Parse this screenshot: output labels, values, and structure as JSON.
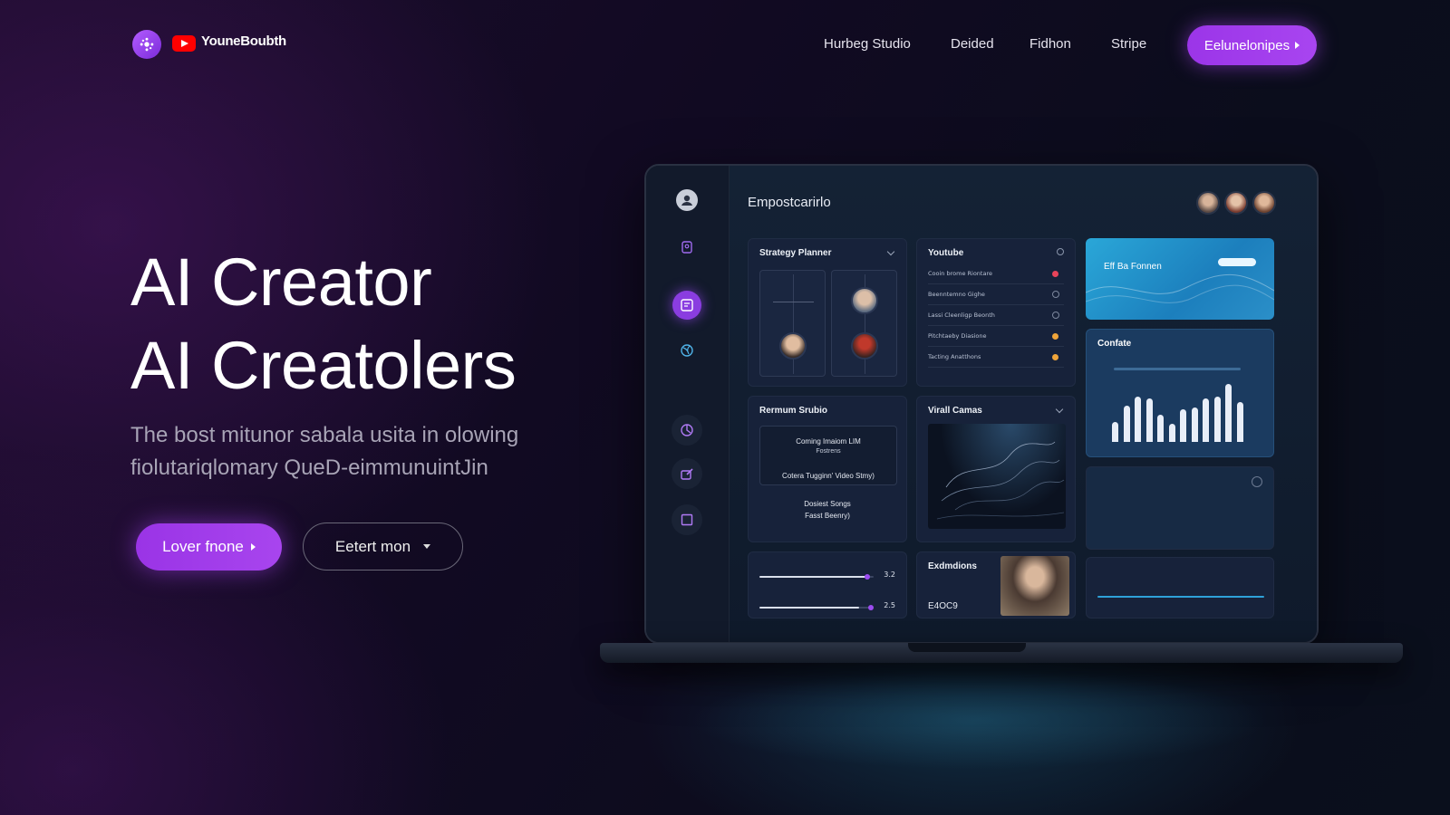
{
  "nav": {
    "brand": "YouneBoubth",
    "links": [
      "Hurbeg Studio",
      "Deided",
      "Fidhon",
      "Stripe"
    ],
    "cta": "Eelunelonipes"
  },
  "hero": {
    "title_line1": "AI Creator",
    "title_line2": "AI Creatolers",
    "subtitle_line1": "The bost mitunor sabala usita in olowing",
    "subtitle_line2": "fiolutariqlomary QueD-eimmunuintJin",
    "primary_button": "Lover fnone",
    "secondary_button": "Eetert mon"
  },
  "dashboard": {
    "title": "Empostcarirlo",
    "strategy_planner": {
      "title": "Strategy Planner"
    },
    "youtube": {
      "title": "Youtube",
      "rows": [
        {
          "label": "Cooin brome Riontare",
          "marker": "dot",
          "color": "#e8445a"
        },
        {
          "label": "Beenntemno Gighe",
          "marker": "ring",
          "color": ""
        },
        {
          "label": "Lassi Cleenligp Beonth",
          "marker": "ring",
          "color": ""
        },
        {
          "label": "Pitchtaeby Diasione",
          "marker": "dot",
          "color": "#f0a53a"
        },
        {
          "label": "Tacting Anatthons",
          "marker": "dot",
          "color": "#f0a53a"
        }
      ]
    },
    "promo_card": {
      "title": "Eff Ba Fonnen"
    },
    "premium_studio": {
      "title": "Rermum Srubio",
      "line1": "Coming Imaiom LIM",
      "line2": "Fostrens",
      "line3": "Cotera Tugginn' Video Stmy)",
      "line4": "Dosiest Songs",
      "line5": "Fasst Beenry)"
    },
    "visual_canvas": {
      "title": "Virall Camas"
    },
    "content_chart": {
      "title": "Confate"
    },
    "progress": {
      "value1": "3.2",
      "value2": "2.5"
    },
    "extractions": {
      "title": "Exdmdions",
      "value": "E4OC9"
    }
  },
  "colors": {
    "accent": "#a23ff0",
    "background": "#120b22"
  }
}
